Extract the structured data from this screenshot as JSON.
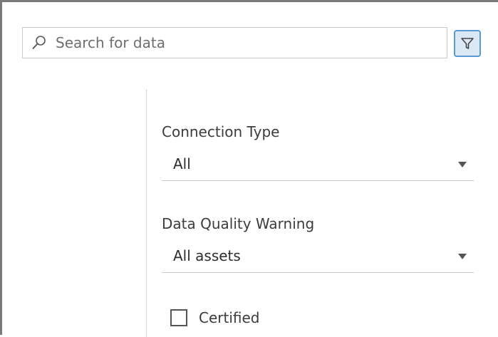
{
  "search": {
    "placeholder": "Search for data",
    "value": "",
    "icon": "search-icon"
  },
  "filter_button": {
    "icon": "filter-icon",
    "active": true,
    "accent_color": "#5b9bd5"
  },
  "filters": {
    "connection_type": {
      "label": "Connection Type",
      "selected": "All"
    },
    "data_quality_warning": {
      "label": "Data Quality Warning",
      "selected": "All assets"
    },
    "certified": {
      "label": "Certified",
      "checked": false
    }
  }
}
